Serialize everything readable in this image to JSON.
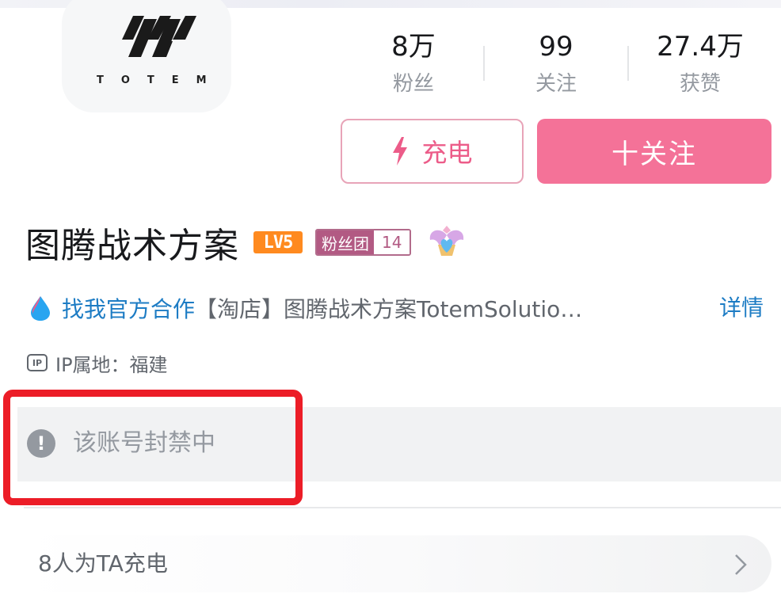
{
  "avatar": {
    "logo_text": "TOTEM",
    "icon": "totem-logo-icon"
  },
  "stats": [
    {
      "value": "8万",
      "label": "粉丝"
    },
    {
      "value": "99",
      "label": "关注"
    },
    {
      "value": "27.4万",
      "label": "获赞"
    }
  ],
  "actions": {
    "charge_label": "充电",
    "follow_label": "十关注"
  },
  "profile": {
    "name": "图腾战术方案",
    "level_badge": "LV5",
    "fan_group_name": "粉丝团",
    "fan_group_level": "14",
    "medal_icon": "winged-heart-medal-icon"
  },
  "description": {
    "link_text": "找我官方合作",
    "text": "【淘店】图腾战术方案TotemSolutio…",
    "detail_label": "详情"
  },
  "ip": {
    "icon_text": "IP",
    "text": "IP属地：福建"
  },
  "ban_notice": {
    "icon": "exclamation-icon",
    "text": "该账号封禁中"
  },
  "charge_summary": {
    "text": "8人为TA充电"
  },
  "colors": {
    "accent_pink": "#f47298",
    "link_blue": "#1d7cc4",
    "highlight_red": "#ec1d27",
    "level_orange": "#ff8a1f"
  }
}
